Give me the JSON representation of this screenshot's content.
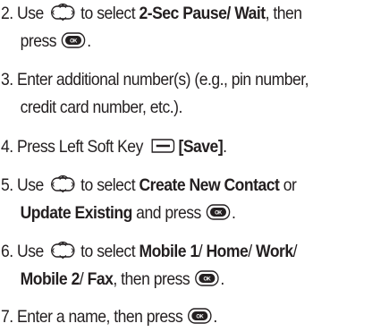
{
  "steps": [
    {
      "num": "2.",
      "use": "Use",
      "to_select": "to select",
      "bold": "2-Sec Pause/ Wait",
      "then": ", then",
      "press": "press",
      "end": "."
    },
    {
      "num": "3.",
      "text1": "Enter additional number(s) (e.g., pin number,",
      "text2": "credit card number, etc.)."
    },
    {
      "num": "4.",
      "text": "Press Left Soft Key",
      "bold": "[Save]",
      "end": "."
    },
    {
      "num": "5.",
      "use": "Use",
      "to_select": "to select",
      "bold1": "Create New Contact",
      "or": "or",
      "bold2": "Update Existing",
      "and_press": "and press",
      "end": "."
    },
    {
      "num": "6.",
      "use": "Use",
      "to_select": "to select",
      "bold1": "Mobile 1",
      "sep1": "/",
      "bold2": "Home",
      "sep2": "/",
      "bold3": "Work",
      "sep3": "/",
      "bold4": "Mobile 2",
      "sep4": "/",
      "bold5": "Fax",
      "then_press": ", then press",
      "end": "."
    },
    {
      "num": "7.",
      "text": "Enter a name, then press",
      "end": "."
    }
  ],
  "icons": {
    "nav": "navigation-key-icon",
    "ok": "ok-key-icon",
    "soft": "left-soft-key-icon"
  },
  "ok_label": "OK"
}
